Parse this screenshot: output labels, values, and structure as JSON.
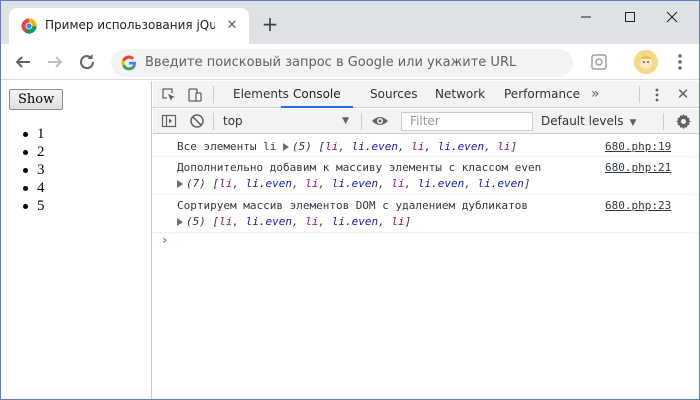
{
  "browser": {
    "tab_title": "Пример использования jQuery",
    "tab_close": "✕",
    "new_tab": "+",
    "omnibox_placeholder": "Введите поисковый запрос в Google или укажите URL"
  },
  "page": {
    "button_label": "Show",
    "list": [
      "1",
      "2",
      "3",
      "4",
      "5"
    ]
  },
  "devtools": {
    "tabs": [
      "Elements",
      "Console",
      "Sources",
      "Network",
      "Performance"
    ],
    "active_tab": "Console",
    "more": "»",
    "close": "✕",
    "context": "top",
    "context_arrow": "▼",
    "filter_placeholder": "Filter",
    "levels": "Default levels",
    "levels_arrow": "▼"
  },
  "console": {
    "messages": [
      {
        "text": "Все элементы li",
        "count": "(5)",
        "items": [
          "li",
          "li.even",
          "li",
          "li.even",
          "li"
        ],
        "source": "680.php:19"
      },
      {
        "text": "Дополнительно добавим к массиву элементы с классом even",
        "count": "(7)",
        "items": [
          "li",
          "li.even",
          "li",
          "li.even",
          "li",
          "li.even",
          "li.even"
        ],
        "source": "680.php:21"
      },
      {
        "text": "Сортируем массив элементов DOM с удалением дубликатов",
        "count": "(5)",
        "items": [
          "li",
          "li.even",
          "li",
          "li.even",
          "li"
        ],
        "source": "680.php:23"
      }
    ],
    "prompt": "›"
  },
  "colors": {
    "accent": "#1a73e8",
    "tag_color": "#881280",
    "class_color": "#1a1aa6"
  }
}
